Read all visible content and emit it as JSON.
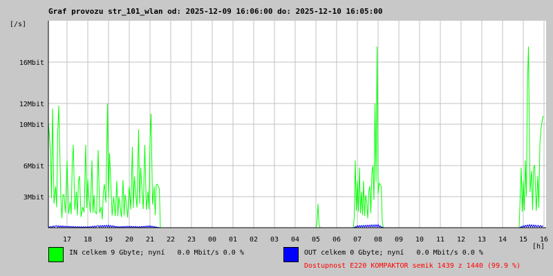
{
  "title": "Graf provozu str_101_wlan od: 2025-12-09 16:06:00 do: 2025-12-10 16:05:00",
  "colors": {
    "in": "#00ff00",
    "out": "#0000ff",
    "grid": "#c0c0c0",
    "background": "#ffffff",
    "availability": "#ff0000"
  },
  "chart_data": {
    "type": "area",
    "title": "Graf provozu str_101_wlan od: 2025-12-09 16:06:00 do: 2025-12-10 16:05:00",
    "ylabel": "[/s]",
    "xlabel": "[h]",
    "y_unit": "Mbit",
    "ylim": [
      0,
      20
    ],
    "y_ticks": [
      {
        "value": 3,
        "label": "3Mbit"
      },
      {
        "value": 6,
        "label": "6Mbit"
      },
      {
        "value": 10,
        "label": "10Mbit"
      },
      {
        "value": 12,
        "label": "12Mbit"
      },
      {
        "value": 16,
        "label": "16Mbit"
      }
    ],
    "x_ticks": [
      "17",
      "18",
      "19",
      "20",
      "21",
      "22",
      "23",
      "00",
      "01",
      "02",
      "03",
      "04",
      "05",
      "06",
      "07",
      "08",
      "09",
      "10",
      "11",
      "12",
      "13",
      "14",
      "15",
      "16"
    ],
    "grid": true,
    "series": [
      {
        "name": "IN",
        "color": "#00ff00",
        "points": [
          [
            16.1,
            10.2
          ],
          [
            16.2,
            7.5
          ],
          [
            16.3,
            11.5
          ],
          [
            16.45,
            4.0
          ],
          [
            16.6,
            11.8
          ],
          [
            16.7,
            3.0
          ],
          [
            16.85,
            3.2
          ],
          [
            17.0,
            6.5
          ],
          [
            17.15,
            2.5
          ],
          [
            17.3,
            8.0
          ],
          [
            17.45,
            3.5
          ],
          [
            17.6,
            5.0
          ],
          [
            17.75,
            2.0
          ],
          [
            17.9,
            8.0
          ],
          [
            18.05,
            3.0
          ],
          [
            18.2,
            6.5
          ],
          [
            18.35,
            1.5
          ],
          [
            18.5,
            7.5
          ],
          [
            18.65,
            2.0
          ],
          [
            18.8,
            4.2
          ],
          [
            18.95,
            12.0
          ],
          [
            19.1,
            4.8
          ],
          [
            19.25,
            3.0
          ],
          [
            19.4,
            4.5
          ],
          [
            19.55,
            2.2
          ],
          [
            19.7,
            4.6
          ],
          [
            19.85,
            2.5
          ],
          [
            20.0,
            4.0
          ],
          [
            20.15,
            7.8
          ],
          [
            20.3,
            3.5
          ],
          [
            20.45,
            9.5
          ],
          [
            20.6,
            4.0
          ],
          [
            20.75,
            8.0
          ],
          [
            20.9,
            3.5
          ],
          [
            21.05,
            11.0
          ],
          [
            21.2,
            4.0
          ],
          [
            21.35,
            4.2
          ],
          [
            21.45,
            3.8
          ],
          [
            21.5,
            0
          ],
          [
            5.0,
            0
          ],
          [
            5.1,
            2.3
          ],
          [
            5.2,
            0
          ],
          [
            6.8,
            0
          ],
          [
            6.9,
            6.5
          ],
          [
            7.0,
            4.5
          ],
          [
            7.1,
            5.8
          ],
          [
            7.2,
            3.5
          ],
          [
            7.3,
            4.5
          ],
          [
            7.45,
            2.5
          ],
          [
            7.6,
            4.0
          ],
          [
            7.75,
            6.0
          ],
          [
            7.85,
            12.0
          ],
          [
            7.95,
            17.5
          ],
          [
            8.05,
            4.3
          ],
          [
            8.15,
            4.0
          ],
          [
            8.25,
            0
          ],
          [
            14.8,
            0
          ],
          [
            14.9,
            5.8
          ],
          [
            15.0,
            4.5
          ],
          [
            15.1,
            6.5
          ],
          [
            15.25,
            17.5
          ],
          [
            15.4,
            5.5
          ],
          [
            15.55,
            6.0
          ],
          [
            15.7,
            5.0
          ],
          [
            15.85,
            9.5
          ],
          [
            15.95,
            10.8
          ]
        ]
      },
      {
        "name": "OUT",
        "color": "#0000ff",
        "points": [
          [
            16.1,
            0.1
          ],
          [
            16.5,
            0.2
          ],
          [
            17.0,
            0.15
          ],
          [
            17.5,
            0.1
          ],
          [
            18.0,
            0.1
          ],
          [
            18.5,
            0.2
          ],
          [
            19.0,
            0.25
          ],
          [
            19.5,
            0.1
          ],
          [
            20.0,
            0.15
          ],
          [
            20.5,
            0.1
          ],
          [
            21.0,
            0.2
          ],
          [
            21.5,
            0
          ],
          [
            6.8,
            0
          ],
          [
            7.0,
            0.2
          ],
          [
            7.5,
            0.25
          ],
          [
            8.0,
            0.3
          ],
          [
            8.25,
            0
          ],
          [
            14.8,
            0
          ],
          [
            15.0,
            0.2
          ],
          [
            15.3,
            0.3
          ],
          [
            15.6,
            0.25
          ],
          [
            15.95,
            0.2
          ]
        ]
      }
    ]
  },
  "legend": {
    "in_text": "IN celkem 9 Gbyte; nyní   0.0 Mbit/s 0.0 %",
    "out_text": "OUT celkem 0 Gbyte; nyní   0.0 Mbit/s 0.0 %",
    "availability_text": "Dostupnost E220 KOMPAKTOR semik 1439 z 1440 (99.9 %)"
  }
}
